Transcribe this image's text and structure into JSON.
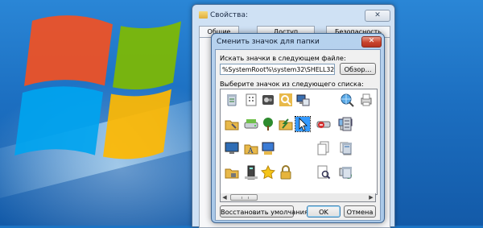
{
  "properties_window": {
    "title": "Свойства:",
    "close_label": "✕",
    "tabs": [
      "Общие",
      "Доступ",
      "Безопасность"
    ]
  },
  "dialog": {
    "title": "Сменить значок для папки",
    "close_label": "✕",
    "search_label": "Искать значки в следующем файле:",
    "path_value": "%SystemRoot%\\system32\\SHELL32.dll",
    "browse_label": "Обзор...",
    "list_label": "Выберите значок из следующего списка:",
    "restore_label": "Восстановить умолчания",
    "ok_label": "OK",
    "cancel_label": "Отмена"
  },
  "icons": [
    {
      "name": "recycle-bin-icon",
      "row": 0,
      "col": 0
    },
    {
      "name": "document-dots-icon",
      "row": 0,
      "col": 1
    },
    {
      "name": "film-reel-icon",
      "row": 0,
      "col": 2
    },
    {
      "name": "key-search-icon",
      "row": 0,
      "col": 3
    },
    {
      "name": "network-computer-icon",
      "row": 0,
      "col": 4
    },
    {
      "name": "magnifier-globe-icon",
      "row": 0,
      "col": 7
    },
    {
      "name": "printer-icon",
      "row": 0,
      "col": 8
    },
    {
      "name": "folder-tools-icon",
      "row": 1,
      "col": 0
    },
    {
      "name": "hard-drive-icon",
      "row": 1,
      "col": 1
    },
    {
      "name": "tree-icon",
      "row": 1,
      "col": 2
    },
    {
      "name": "shortcut-arrow-icon",
      "row": 1,
      "col": 3
    },
    {
      "name": "cursor-icon",
      "row": 1,
      "col": 4,
      "selected": true
    },
    {
      "name": "no-drive-icon",
      "row": 1,
      "col": 5
    },
    {
      "name": "network-drive-icon",
      "row": 1,
      "col": 6
    },
    {
      "name": "server-icon",
      "row": 1,
      "col": 7
    },
    {
      "name": "monitor-icon",
      "row": 2,
      "col": 0
    },
    {
      "name": "font-folder-icon",
      "row": 2,
      "col": 1
    },
    {
      "name": "computer-display-icon",
      "row": 2,
      "col": 2
    },
    {
      "name": "documents-stack-icon",
      "row": 2,
      "col": 5
    },
    {
      "name": "files-icon",
      "row": 2,
      "col": 6
    },
    {
      "name": "trash-full-icon",
      "row": 2,
      "col": 7
    },
    {
      "name": "folder-lock-icon",
      "row": 3,
      "col": 0
    },
    {
      "name": "tower-computer-icon",
      "row": 3,
      "col": 1
    },
    {
      "name": "star-icon",
      "row": 3,
      "col": 2
    },
    {
      "name": "padlock-icon",
      "row": 3,
      "col": 3
    },
    {
      "name": "search-document-icon",
      "row": 3,
      "col": 5
    },
    {
      "name": "add-device-icon",
      "row": 3,
      "col": 6
    },
    {
      "name": "bin-empty-icon",
      "row": 3,
      "col": 7
    }
  ],
  "colors": {
    "selection": "#3399ff",
    "folder": "#e8b94a",
    "close_red": "#c8432c"
  }
}
